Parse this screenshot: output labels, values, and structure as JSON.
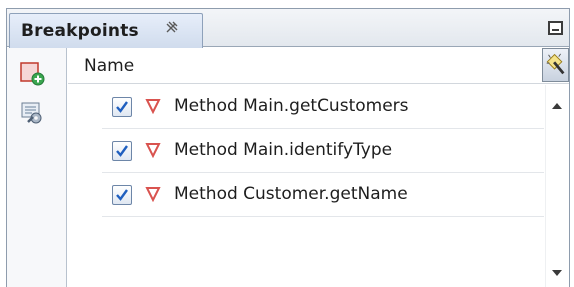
{
  "tab": {
    "title": "Breakpoints"
  },
  "header": {
    "column_name": "Name"
  },
  "breakpoints": [
    {
      "label": "Method Main.getCustomers",
      "checked": true
    },
    {
      "label": "Method Main.identifyType",
      "checked": true
    },
    {
      "label": "Method Customer.getName",
      "checked": true
    }
  ],
  "icons": {
    "close": "close-icon",
    "minimize": "minimize-icon",
    "new_breakpoint": "new-breakpoint-icon",
    "settings": "settings-icon",
    "header_action": "magic-wand-icon",
    "breakpoint": "method-breakpoint-icon"
  },
  "colors": {
    "breakpoint": "#d9534f",
    "check": "#1f5fbf",
    "accent": "#3aa64f"
  }
}
